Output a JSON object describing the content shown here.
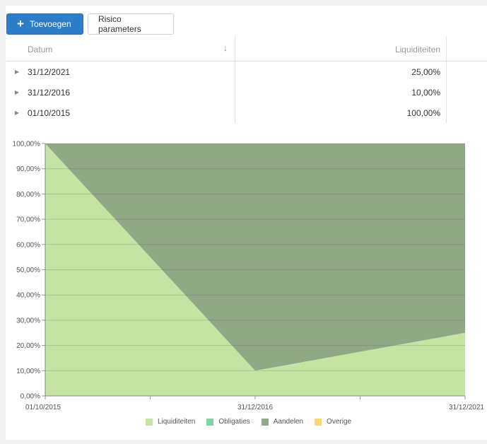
{
  "toolbar": {
    "add_label": "Toevoegen",
    "risk_label": "Risico parameters"
  },
  "grid": {
    "columns": [
      "Datum",
      "Liquiditeiten"
    ],
    "rows": [
      {
        "date": "31/12/2021",
        "liq": "25,00%"
      },
      {
        "date": "31/12/2016",
        "liq": "10,00%"
      },
      {
        "date": "01/10/2015",
        "liq": "100,00%"
      }
    ]
  },
  "chart_data": {
    "type": "area",
    "stacked": true,
    "x": [
      "01/10/2015",
      "31/12/2016",
      "31/12/2021"
    ],
    "x_ticks": [
      "01/10/2015",
      "31/12/2016",
      "31/12/2021"
    ],
    "ylim": [
      0,
      100
    ],
    "y_ticks": [
      "0,00%",
      "10,00%",
      "20,00%",
      "30,00%",
      "40,00%",
      "50,00%",
      "60,00%",
      "70,00%",
      "80,00%",
      "90,00%",
      "100,00%"
    ],
    "grid": true,
    "legend_position": "bottom",
    "series": [
      {
        "name": "Liquiditeiten",
        "values": [
          100,
          10,
          25
        ],
        "color": "#c5e4a3"
      },
      {
        "name": "Obligaties",
        "values": [
          0,
          0,
          0
        ],
        "color": "#7fd3a4"
      },
      {
        "name": "Aandelen",
        "values": [
          0,
          90,
          75
        ],
        "color": "#90a886"
      },
      {
        "name": "Overige",
        "values": [
          0,
          0,
          0
        ],
        "color": "#f7d774"
      }
    ]
  }
}
